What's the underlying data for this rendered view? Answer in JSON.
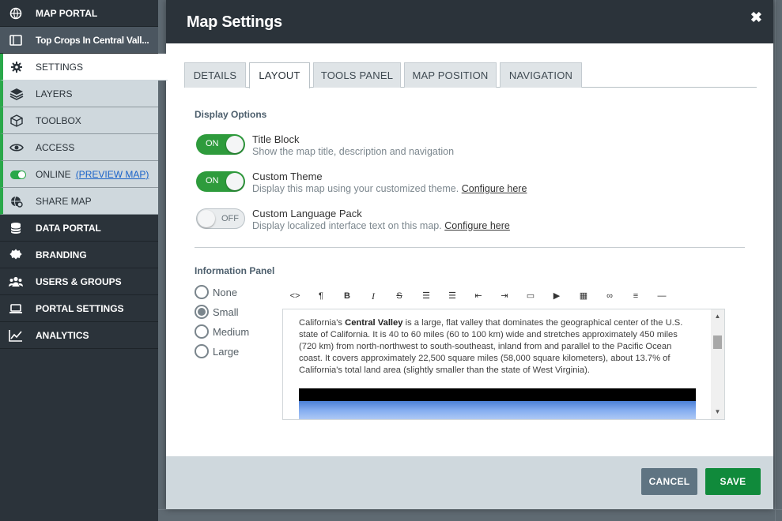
{
  "sidebar": {
    "items": [
      {
        "label": "MAP PORTAL",
        "icon": "globe-icon"
      },
      {
        "label": "Top Crops In Central Vall...",
        "icon": "map-icon"
      },
      {
        "label": "SETTINGS",
        "icon": "gear-icon"
      },
      {
        "label": "LAYERS",
        "icon": "layers-icon"
      },
      {
        "label": "TOOLBOX",
        "icon": "box-icon"
      },
      {
        "label": "ACCESS",
        "icon": "eye-icon"
      },
      {
        "label": "ONLINE",
        "icon": "toggle-icon",
        "link": "(PREVIEW MAP)"
      },
      {
        "label": "SHARE MAP",
        "icon": "share-globe-icon"
      },
      {
        "label": "DATA PORTAL",
        "icon": "database-icon"
      },
      {
        "label": "BRANDING",
        "icon": "badge-icon"
      },
      {
        "label": "USERS & GROUPS",
        "icon": "users-icon"
      },
      {
        "label": "PORTAL SETTINGS",
        "icon": "laptop-icon"
      },
      {
        "label": "ANALYTICS",
        "icon": "chart-icon"
      }
    ]
  },
  "modal": {
    "title": "Map Settings",
    "close": "✖",
    "tabs": [
      "DETAILS",
      "LAYOUT",
      "TOOLS PANEL",
      "MAP POSITION",
      "NAVIGATION"
    ],
    "active_tab": "LAYOUT",
    "display_options": {
      "heading": "Display Options",
      "options": [
        {
          "title": "Title Block",
          "description": "Show the map title, description and navigation",
          "state": "ON",
          "link": ""
        },
        {
          "title": "Custom Theme",
          "description": "Display this map using your customized theme.",
          "state": "ON",
          "link": "Configure here"
        },
        {
          "title": "Custom Language Pack",
          "description": "Display localized interface text on this map.",
          "state": "OFF",
          "link": "Configure here"
        }
      ]
    },
    "info_panel": {
      "heading": "Information Panel",
      "sizes": [
        "None",
        "Small",
        "Medium",
        "Large"
      ],
      "selected": "Small",
      "toolbar": [
        "code-icon",
        "paragraph-icon",
        "bold-icon",
        "italic-icon",
        "strikethrough-icon",
        "bullet-list-icon",
        "numbered-list-icon",
        "outdent-icon",
        "indent-icon",
        "image-icon",
        "video-icon",
        "table-icon",
        "link-icon",
        "align-icon",
        "horizontal-rule-icon"
      ],
      "content": {
        "before": "California's ",
        "bold": "Central Valley",
        "after": " is a large, flat valley that dominates the geographical center of the U.S. state of California. It is 40 to 60 miles (60 to 100 km) wide and stretches approximately 450 miles (720 km) from north-northwest to south-southeast, inland from and parallel to the Pacific Ocean coast. It covers approximately 22,500 square miles (58,000 square kilometers), about 13.7% of California's total land area (slightly smaller than the state of West Virginia)."
      }
    },
    "footer": {
      "cancel": "CANCEL",
      "save": "SAVE"
    }
  },
  "colors": {
    "sidebar": "#2b333a",
    "active_accent": "#2aa84a",
    "save": "#108a3b",
    "cancel": "#5f7482"
  }
}
